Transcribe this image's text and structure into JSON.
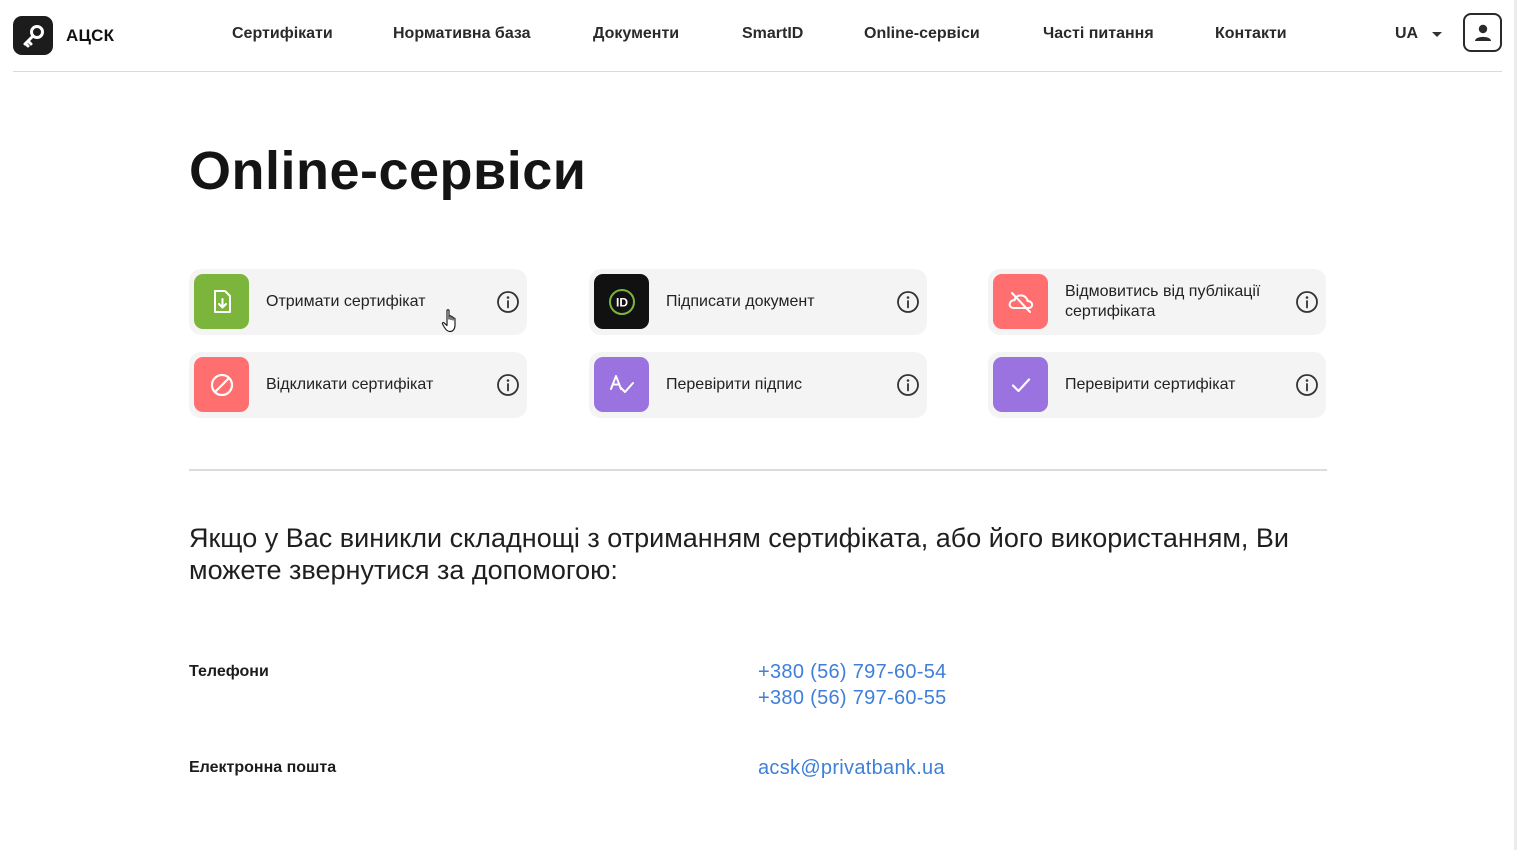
{
  "header": {
    "logo_text": "АЦСК",
    "nav": [
      {
        "label": "Сертифікати"
      },
      {
        "label": "Нормативна база"
      },
      {
        "label": "Документи"
      },
      {
        "label": "SmartID"
      },
      {
        "label": "Online-сервіси"
      },
      {
        "label": "Часті питання"
      },
      {
        "label": "Контакти"
      }
    ],
    "language": "UA"
  },
  "main": {
    "title": "Online-сервіси",
    "services": [
      {
        "label": "Отримати сертифікат",
        "icon": "document-download-icon",
        "color": "#7cb53b"
      },
      {
        "label": "Підписати документ",
        "icon": "id-icon",
        "color": "#111111"
      },
      {
        "label": "Відмовитись від публікації сертифіката",
        "icon": "cloud-off-icon",
        "color": "#ff6f6f"
      },
      {
        "label": "Відкликати сертифікат",
        "icon": "block-icon",
        "color": "#ff6f6f"
      },
      {
        "label": "Перевірити підпис",
        "icon": "signature-check-icon",
        "color": "#9b73e0"
      },
      {
        "label": "Перевірити сертифікат",
        "icon": "check-icon",
        "color": "#9b73e0"
      }
    ],
    "help_text": "Якщо у Вас виникли складнощі з отриманням сертифіката, або його використанням, Ви можете звернутися за допомогою:",
    "contacts": {
      "phones_label": "Телефони",
      "phones": [
        "+380 (56) 797-60-54",
        "+380 (56) 797-60-55"
      ],
      "email_label": "Електронна пошта",
      "email": "acsk@privatbank.ua"
    }
  },
  "colors": {
    "accent_link": "#3e7fd9",
    "card_bg": "#f4f4f4"
  }
}
